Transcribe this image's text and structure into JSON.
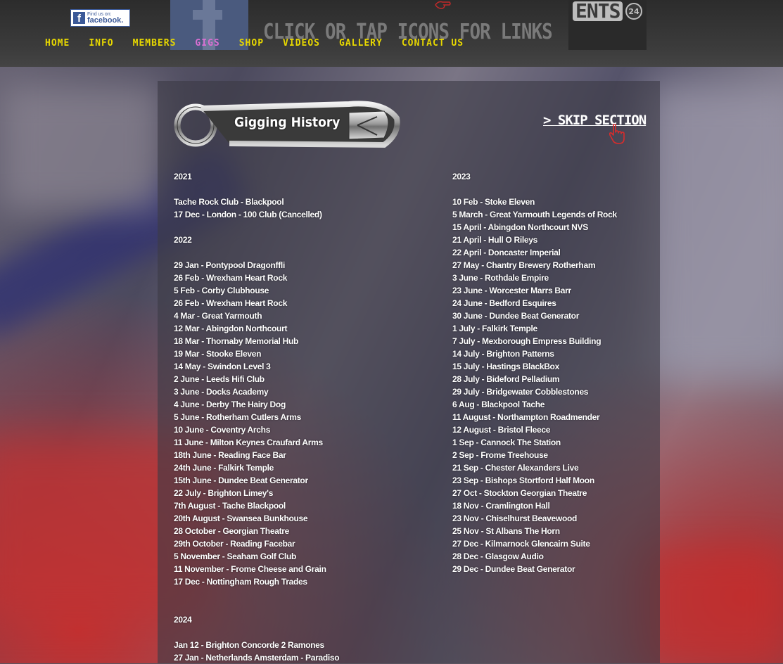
{
  "header": {
    "facebook_badge": {
      "line1": "Find us on:",
      "line2": "facebook."
    },
    "cta_text": "Click or tap icons for  links",
    "ents": {
      "word": "ENTS",
      "number": "24"
    }
  },
  "nav": {
    "items": [
      {
        "label": "Home"
      },
      {
        "label": "Info"
      },
      {
        "label": "Members"
      },
      {
        "label": "Gigs"
      },
      {
        "label": "Shop"
      },
      {
        "label": "Videos"
      },
      {
        "label": "Gallery"
      },
      {
        "label": "Contact Us"
      }
    ],
    "active": "Gigs"
  },
  "section": {
    "title": "Gigging History",
    "skip_label": "> SKIP SECTION"
  },
  "left_column": {
    "y2021": "2021",
    "gigs2021": [
      "Tache Rock Club - Blackpool",
      "17 Dec - London - 100 Club (Cancelled)"
    ],
    "y2022": "2022",
    "gigs2022": [
      "29 Jan - Pontypool Dragonffli",
      "26 Feb - Wrexham Heart Rock",
      "5 Feb - Corby Clubhouse",
      "26 Feb - Wrexham Heart Rock",
      "4 Mar - Great Yarmouth",
      "12 Mar - Abingdon Northcourt",
      "18 Mar - Thornaby Memorial Hub",
      "19 Mar - Stooke Eleven",
      "14 May - Swindon Level 3",
      "2 June - Leeds Hifi Club",
      "3 June - Docks Academy",
      "4 June - Derby The Hairy Dog",
      "5 June - Rotherham Cutlers Arms",
      "10 June - Coventry Archs",
      "11 June - Milton Keynes Craufard Arms",
      "18th June - Reading Face Bar",
      "24th June - Falkirk Temple",
      "15th June - Dundee Beat Generator",
      "22 July - Brighton Limey's",
      "7th August - Tache Blackpool",
      "20th August - Swansea Bunkhouse",
      "28 October - Georgian Theatre",
      "29th October - Reading Facebar",
      "5 November - Seaham Golf Club",
      "11 November - Frome Cheese and Grain",
      "17 Dec - Nottingham Rough Trades"
    ],
    "y2024": "2024",
    "gigs2024": [
      "Jan 12 - Brighton Concorde 2 Ramones",
      "27 Jan - Netherlands Amsterdam - Paradiso"
    ]
  },
  "right_column": {
    "y2023": "2023",
    "gigs2023": [
      "10 Feb - Stoke Eleven",
      "5 March - Great Yarmouth Legends of Rock",
      "15 April - Abingdon Northcourt NVS",
      "21 April - Hull O Rileys",
      "22 April - Doncaster Imperial",
      "27 May - Chantry Brewery Rotherham",
      "3 June - Rothdale Empire",
      "23 June - Worcester Marrs Barr",
      "24 June - Bedford Esquires",
      "30 June - Dundee Beat Generator",
      "1 July - Falkirk Temple",
      "7 July - Mexborough Empress Building",
      "14 July - Brighton Patterns",
      "15 July - Hastings BlackBox",
      "28 July - Bideford Pelladium",
      "29 July - Bridgewater Cobblestones",
      "6 Aug - Blackpool Tache",
      "11 August - Northampton Roadmender",
      "12 August - Bristol Fleece",
      "1 Sep - Cannock The Station",
      "2 Sep - Frome Treehouse",
      "21 Sep - Chester Alexanders Live",
      "23 Sep - Bishops Stortford Half Moon",
      "27 Oct - Stockton Georgian Theatre",
      "18 Nov - Cramlington Hall",
      "23 Nov - Chiselhurst Beavewood",
      "25 Nov - St Albans The Horn",
      "27 Dec - Kilmarnock Glencairn Suite",
      "28 Dec - Glasgow Audio",
      "29 Dec - Dundee Beat Generator"
    ]
  },
  "colors": {
    "nav": "#e8d800",
    "nav_active": "#d96fd3",
    "text": "#ffffff",
    "facebook": "#3b5998"
  }
}
